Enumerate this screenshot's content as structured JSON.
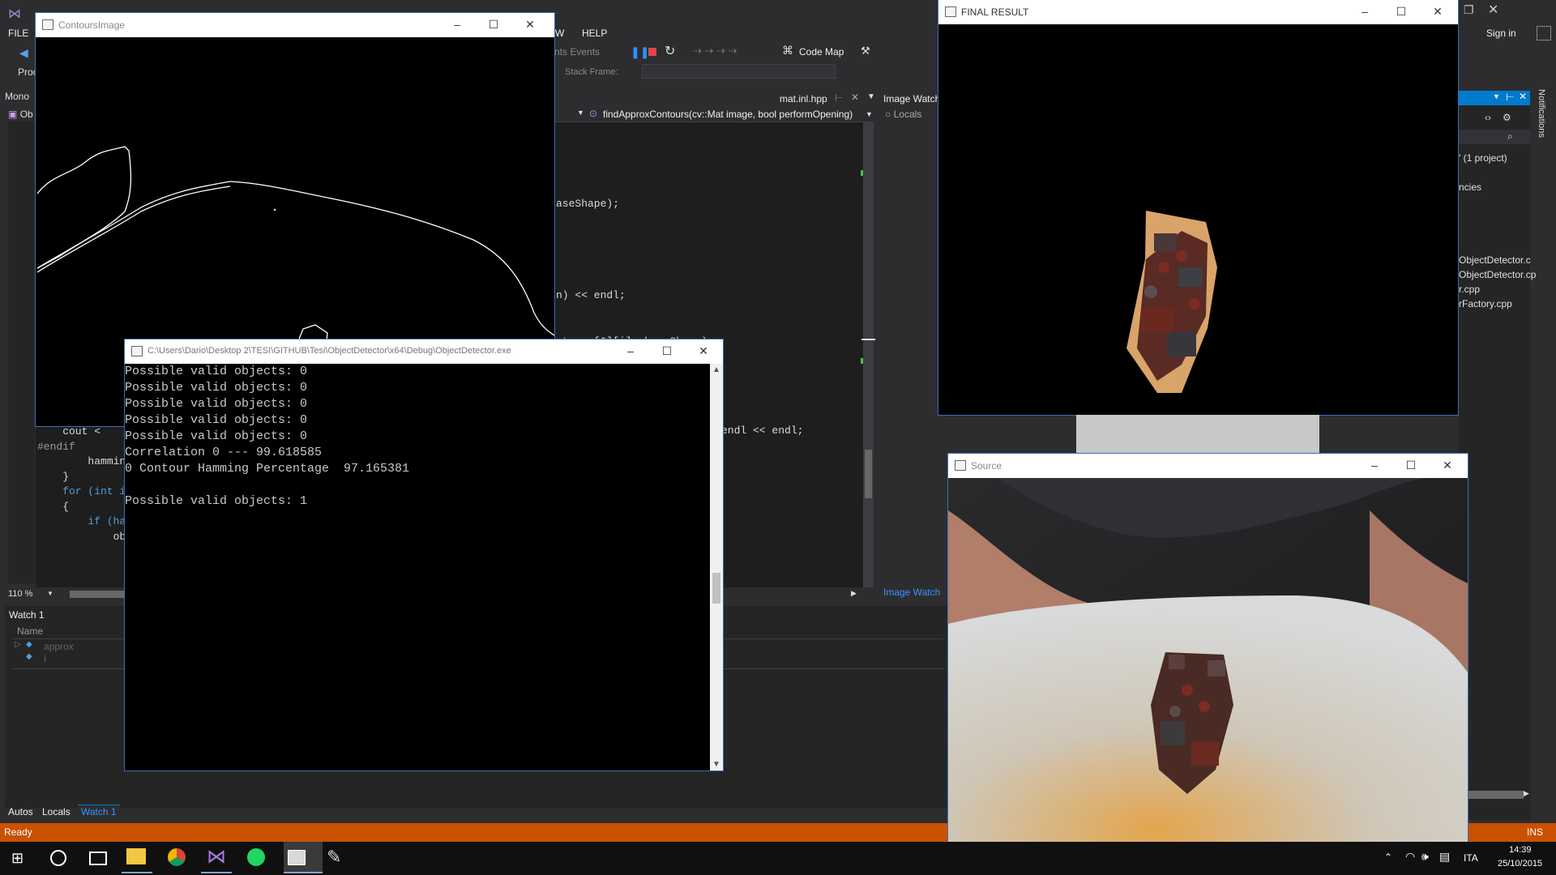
{
  "visual_studio": {
    "menu": {
      "file": "FILE",
      "w": "W",
      "help": "HELP",
      "sign_in": "Sign in"
    },
    "toolbar": {
      "run_events": "nts Events",
      "code_map": "Code Map",
      "stack_frame": "Stack Frame:"
    },
    "tabs": {
      "mono": "Mono",
      "obj": "Ob",
      "mat_tab": "mat.inl.hpp",
      "image_watch": "Image Watch",
      "image_watch_link": "Image Watch",
      "locals_radio": "Locals"
    },
    "function_dropdown": "findApproxContours(cv::Mat image, bool performOpening)",
    "code_lines": [
      {
        "text": "aseShape);",
        "cls": ""
      },
      {
        "text": "n) << endl;",
        "cls": ""
      },
      {
        "text": "ntours[0][i], baseShape);",
        "cls": ""
      },
      {
        "text": "endl << endl;",
        "cls": ""
      }
    ],
    "left_code": [
      {
        "text": "    cout <",
        "cls": ""
      },
      {
        "text": "#endif",
        "cls": "pp"
      },
      {
        "text": "        hammin",
        "cls": ""
      },
      {
        "text": "    }",
        "cls": ""
      },
      {
        "text": "    for (int i",
        "cls": "kw"
      },
      {
        "text": "    {",
        "cls": ""
      },
      {
        "text": "        if (ha",
        "cls": "kw"
      },
      {
        "text": "            ob",
        "cls": ""
      }
    ],
    "zoom": "110 %",
    "watch": {
      "title": "Watch 1",
      "name_col": "Name",
      "rows": [
        "approx",
        "i"
      ]
    },
    "bottom_tabs": [
      "Autos",
      "Locals",
      "Watch 1"
    ],
    "solution": {
      "project": "' (1 project)",
      "deps": "ncies",
      "files": [
        "ObjectDetector.c",
        "ObjectDetector.cp",
        "r.cpp",
        "rFactory.cpp"
      ]
    },
    "notifications": "Notifications",
    "status": {
      "ready": "Ready",
      "ins": "INS"
    }
  },
  "contours_window": {
    "title": "ContoursImage"
  },
  "console_window": {
    "title": "C:\\Users\\Dario\\Desktop 2\\TESI\\GITHUB\\Tesi\\ObjectDetector\\x64\\Debug\\ObjectDetector.exe",
    "lines": [
      "Possible valid objects: 0",
      "Possible valid objects: 0",
      "Possible valid objects: 0",
      "Possible valid objects: 0",
      "Possible valid objects: 0",
      "Correlation 0 --- 99.618585",
      "0 Contour Hamming Percentage  97.165381",
      "",
      "Possible valid objects: 1"
    ]
  },
  "final_window": {
    "title": "FINAL RESULT"
  },
  "source_window": {
    "title": "Source"
  },
  "taskbar": {
    "apps": [
      "start-icon",
      "search-icon",
      "task-view-icon",
      "file-explorer-icon",
      "chrome-icon",
      "visual-studio-icon",
      "spotify-icon",
      "app-window-icon",
      "paint-icon"
    ],
    "lang": "ITA",
    "time": "14:39",
    "date": "25/10/2015"
  },
  "colors": {
    "accent": "#007acc",
    "status_bar": "#ca5100",
    "window_border": "#3c6fb5"
  }
}
